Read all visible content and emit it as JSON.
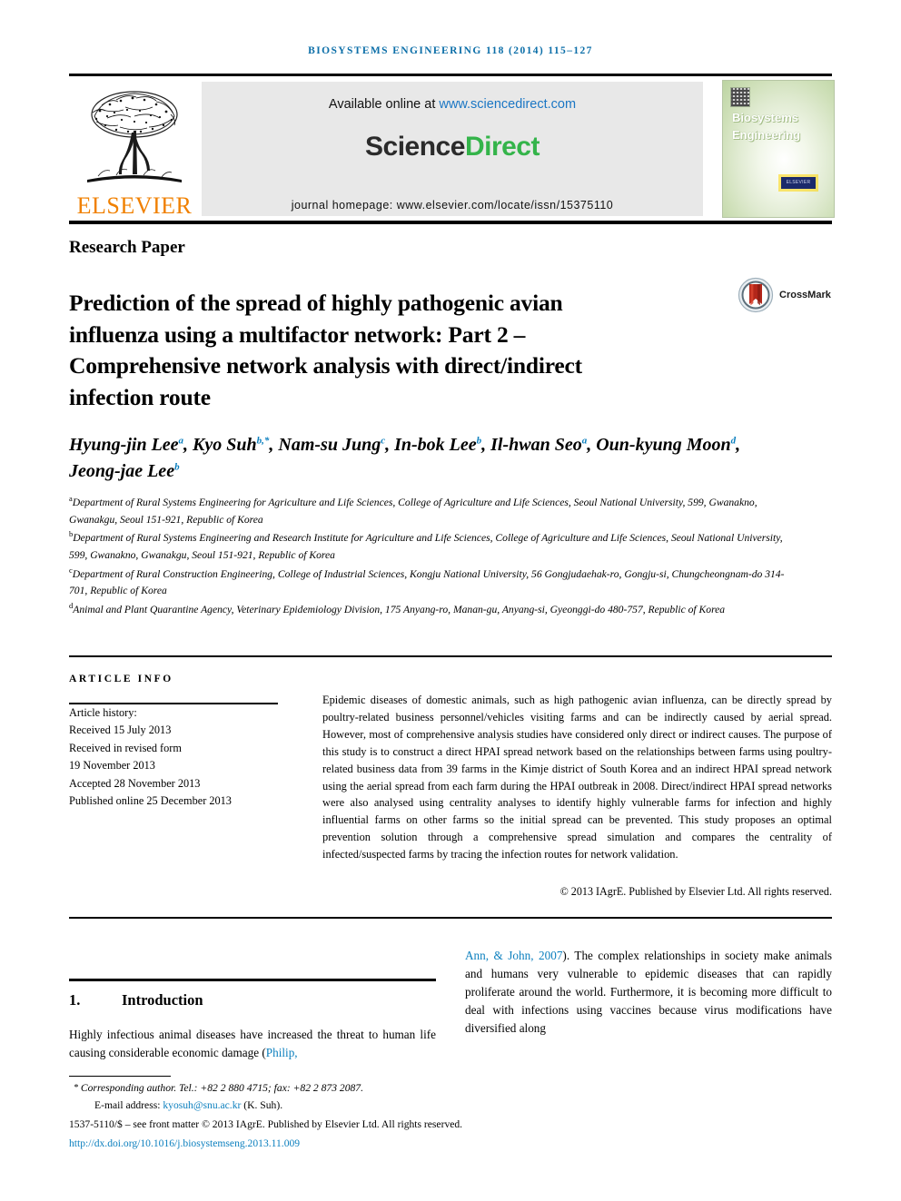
{
  "running_head": "BIOSYSTEMS ENGINEERING 118 (2014) 115–127",
  "header": {
    "available_prefix": "Available online at ",
    "available_url": "www.sciencedirect.com",
    "brand_part1": "Science",
    "brand_part2": "Direct",
    "homepage": "journal homepage: www.elsevier.com/locate/issn/15375110",
    "publisher_logo_text": "ELSEVIER",
    "cover_title_line1": "Biosystems",
    "cover_title_line2": "Engineering",
    "cover_badge": "ELSEVIER"
  },
  "article": {
    "kind": "Research Paper",
    "title": "Prediction of the spread of highly pathogenic avian influenza using a multifactor network: Part 2 – Comprehensive network analysis with direct/indirect infection route",
    "crossmark_label": "CrossMark"
  },
  "authors": {
    "list": [
      {
        "name": "Hyung-jin Lee",
        "sup": "a"
      },
      {
        "name": "Kyo Suh",
        "sup": "b,*"
      },
      {
        "name": "Nam-su Jung",
        "sup": "c"
      },
      {
        "name": "In-bok Lee",
        "sup": "b"
      },
      {
        "name": "Il-hwan Seo",
        "sup": "a"
      },
      {
        "name": "Oun-kyung Moon",
        "sup": "d"
      },
      {
        "name": "Jeong-jae Lee",
        "sup": "b"
      }
    ]
  },
  "affiliations": [
    {
      "mark": "a",
      "text": "Department of Rural Systems Engineering for Agriculture and Life Sciences, College of Agriculture and Life Sciences, Seoul National University, 599, Gwanakno, Gwanakgu, Seoul 151-921, Republic of Korea"
    },
    {
      "mark": "b",
      "text": "Department of Rural Systems Engineering and Research Institute for Agriculture and Life Sciences, College of Agriculture and Life Sciences, Seoul National University, 599, Gwanakno, Gwanakgu, Seoul 151-921, Republic of Korea"
    },
    {
      "mark": "c",
      "text": "Department of Rural Construction Engineering, College of Industrial Sciences, Kongju National University, 56 Gongjudaehak-ro, Gongju-si, Chungcheongnam-do 314-701, Republic of Korea"
    },
    {
      "mark": "d",
      "text": "Animal and Plant Quarantine Agency, Veterinary Epidemiology Division, 175 Anyang-ro, Manan-gu, Anyang-si, Gyeonggi-do 480-757, Republic of Korea"
    }
  ],
  "article_info": {
    "heading": "ARTICLE INFO",
    "history_label": "Article history:",
    "received": "Received 15 July 2013",
    "revised_label": "Received in revised form",
    "revised_date": "19 November 2013",
    "accepted": "Accepted 28 November 2013",
    "published": "Published online 25 December 2013"
  },
  "abstract": {
    "text": "Epidemic diseases of domestic animals, such as high pathogenic avian influenza, can be directly spread by poultry-related business personnel/vehicles visiting farms and can be indirectly caused by aerial spread. However, most of comprehensive analysis studies have considered only direct or indirect causes. The purpose of this study is to construct a direct HPAI spread network based on the relationships between farms using poultry-related business data from 39 farms in the Kimje district of South Korea and an indirect HPAI spread network using the aerial spread from each farm during the HPAI outbreak in 2008. Direct/indirect HPAI spread networks were also analysed using centrality analyses to identify highly vulnerable farms for infection and highly influential farms on other farms so the initial spread can be prevented. This study proposes an optimal prevention solution through a comprehensive spread simulation and compares the centrality of infected/suspected farms by tracing the infection routes for network validation.",
    "copyright": "© 2013 IAgrE. Published by Elsevier Ltd. All rights reserved."
  },
  "body": {
    "section_number": "1.",
    "section_title": "Introduction",
    "left_paragraph_plain": "Highly infectious animal diseases have increased the threat to human life causing considerable economic damage (",
    "left_paragraph_cite": "Philip,",
    "right_cite": "Ann, & John, 2007",
    "right_paragraph": "). The complex relationships in society make animals and humans very vulnerable to epidemic diseases that can rapidly proliferate around the world. Furthermore, it is becoming more difficult to deal with infections using vaccines because virus modifications have diversified along"
  },
  "footer": {
    "corresponding": "Corresponding author. Tel.: +82 2 880 4715; fax: +82 2 873 2087.",
    "email_label": "E-mail address: ",
    "email": "kyosuh@snu.ac.kr",
    "email_suffix": " (K. Suh).",
    "front_matter": "1537-5110/$ – see front matter © 2013 IAgrE. Published by Elsevier Ltd. All rights reserved.",
    "doi": "http://dx.doi.org/10.1016/j.biosystemseng.2013.11.009"
  },
  "colors": {
    "accent_blue": "#0b7fbe",
    "link_blue": "#1a76c4",
    "sciencedirect_green": "#34b44a",
    "elsevier_orange": "#F08000"
  }
}
